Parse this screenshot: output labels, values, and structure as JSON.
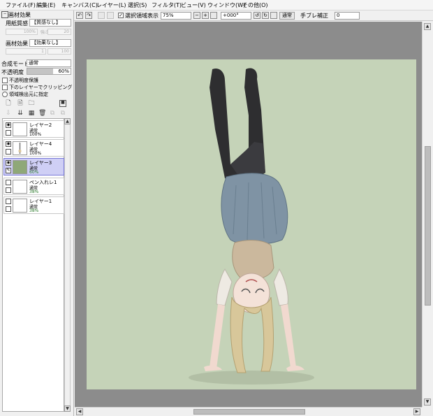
{
  "menubar": {
    "items": [
      "ファイル(F)",
      "編集(E)",
      "キャンバス(C)",
      "レイヤー(L)",
      "選択(S)",
      "フィルタ(T)",
      "ビュー(V)",
      "ウィンドウ(W)",
      "その他(O)"
    ]
  },
  "toolbar": {
    "selection_display_label": "選択領域表示",
    "selection_display_checked": true,
    "zoom_value": "75%",
    "rotation_value": "+000°",
    "mode_button": "通常",
    "stabilizer_label": "手ブレ補正",
    "stabilizer_value": "0"
  },
  "left_panel": {
    "section_title": "画材効果",
    "paper_texture_label": "用紙質感",
    "paper_texture_value": "【質感なし】",
    "paper_scale_disabled": "100%",
    "paper_strength_label": "強さ",
    "paper_strength_disabled": "20",
    "material_effect_label": "画材効果",
    "material_effect_value": "【効果なし】",
    "material_width_disabled": "1",
    "material_strength_disabled": "100",
    "blend_mode_label": "合成モード",
    "blend_mode_value": "通常",
    "opacity_label": "不透明度",
    "opacity_value": "60%",
    "opacity_fraction": 0.6,
    "checkbox_opacity_protect": "不透明度保護",
    "checkbox_clipping": "下のレイヤーでクリッピング",
    "radio_selection_source": "領域検出元に指定"
  },
  "layers": [
    {
      "name": "レイヤー2",
      "mode": "通常",
      "opacity": "100%",
      "visible": true,
      "selected": false,
      "thumb": "white"
    },
    {
      "name": "レイヤー4",
      "mode": "通常",
      "opacity": "100%",
      "visible": true,
      "selected": false,
      "thumb": "figure"
    },
    {
      "name": "レイヤー3",
      "mode": "通常",
      "opacity": "60%",
      "visible": true,
      "selected": true,
      "thumb": "green"
    },
    {
      "name": "ペン入れレ1",
      "mode": "通常",
      "opacity": "38%",
      "visible": false,
      "selected": false,
      "thumb": "white"
    },
    {
      "name": "レイヤー1",
      "mode": "通常",
      "opacity": "38%",
      "visible": false,
      "selected": false,
      "thumb": "white"
    }
  ],
  "colors": {
    "canvas_bg": "#8c8c8c",
    "artboard": "#c5d3b8",
    "selected_layer": "#cfcff5",
    "opacity_low_text": "#2a7a2a"
  }
}
